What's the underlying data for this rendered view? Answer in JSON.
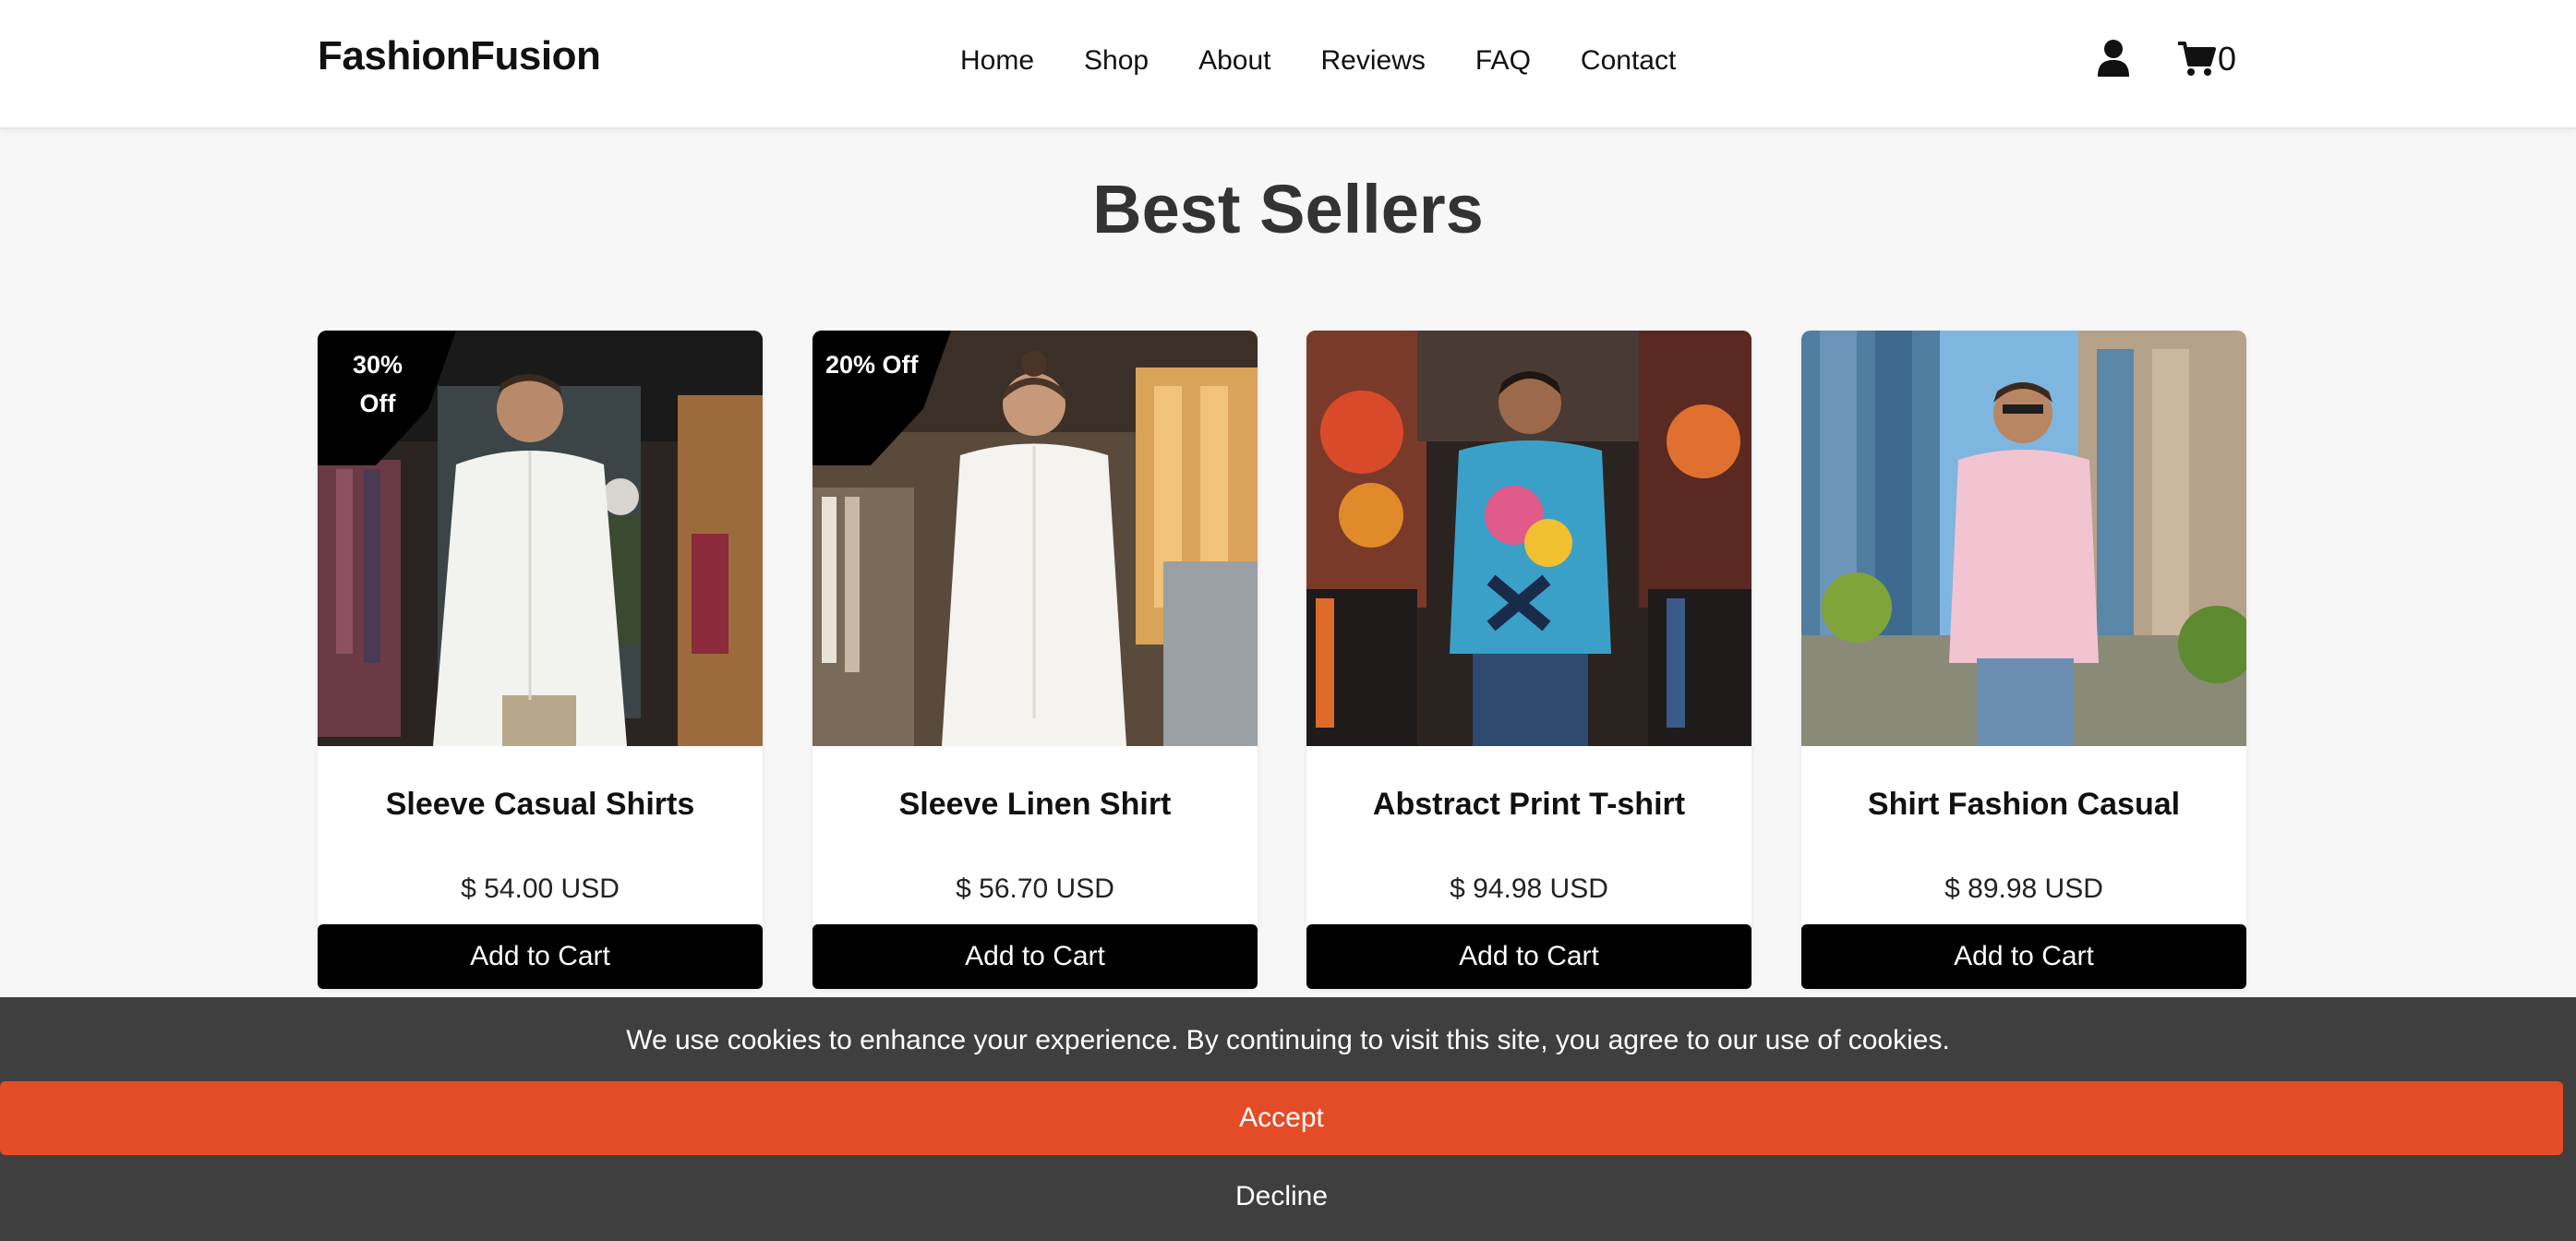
{
  "brand": {
    "name": "FashionFusion"
  },
  "nav": {
    "items": [
      {
        "label": "Home"
      },
      {
        "label": "Shop"
      },
      {
        "label": "About"
      },
      {
        "label": "Reviews"
      },
      {
        "label": "FAQ"
      },
      {
        "label": "Contact"
      }
    ]
  },
  "header": {
    "user_icon": "user-icon",
    "cart_icon": "shopping-cart-icon",
    "cart_count": "0"
  },
  "section": {
    "title": "Best Sellers"
  },
  "products": [
    {
      "name": "Sleeve Casual Shirts",
      "price": "$ 54.00 USD",
      "badge_line1": "30%",
      "badge_line2": "Off",
      "button": "Add to Cart",
      "image": "man in white shirt in clothing store"
    },
    {
      "name": "Sleeve Linen Shirt",
      "price": "$ 56.70 USD",
      "badge_line1": "20% Off",
      "badge_line2": "",
      "button": "Add to Cart",
      "image": "woman in white linen shirt in boutique"
    },
    {
      "name": "Abstract Print T-shirt",
      "price": "$ 94.98 USD",
      "button": "Add to Cart",
      "image": "man in colorful abstract print t-shirt"
    },
    {
      "name": "Shirt Fashion Casual",
      "price": "$ 89.98 USD",
      "button": "Add to Cart",
      "image": "man in pink shirt on city street"
    }
  ],
  "cookie": {
    "message": "We use cookies to enhance your experience. By continuing to visit this site, you agree to our use of cookies.",
    "accept": "Accept",
    "decline": "Decline"
  },
  "colors": {
    "accent": "#e44c28",
    "cookie_bg": "#3f3f3f",
    "button": "#000000",
    "page_bg": "#f7f7f7"
  }
}
